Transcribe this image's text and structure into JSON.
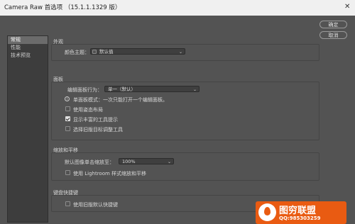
{
  "window": {
    "title": "Camera Raw 首选项 （15.1.1.1329 版）",
    "close_glyph": "✕"
  },
  "nav": {
    "items": [
      {
        "label": "常规",
        "active": true
      },
      {
        "label": "性能",
        "active": false
      },
      {
        "label": "技术预览",
        "active": false
      }
    ]
  },
  "appearance": {
    "title": "外观",
    "theme_label": "颜色主题：",
    "theme_value": "默认值"
  },
  "panels": {
    "title": "面板",
    "behavior_label": "编辑面板行为：",
    "behavior_value": "单一（默认）",
    "behavior_info": "单面板模式：一次只能打开一个编辑面板。",
    "options": [
      {
        "label": "使用姿态布局",
        "checked": false
      },
      {
        "label": "显示丰富的工具提示",
        "checked": true
      },
      {
        "label": "选择旧版目标调整工具",
        "checked": false
      }
    ]
  },
  "zoom": {
    "title": "缩放和平移",
    "default_label": "默认图像单击缩放至：",
    "default_value": "100%",
    "lightroom_label": "使用 Lightroom 样式缩放和平移",
    "lightroom_checked": false
  },
  "shortcuts": {
    "title": "键盘快捷键",
    "legacy_label": "使用旧版默认快捷键",
    "legacy_checked": false
  },
  "buttons": {
    "ok": "确定",
    "cancel": "取消"
  },
  "watermark": {
    "title": "图穷联盟",
    "subtitle": "QQ:985303259",
    "accent": "#e95b12"
  }
}
